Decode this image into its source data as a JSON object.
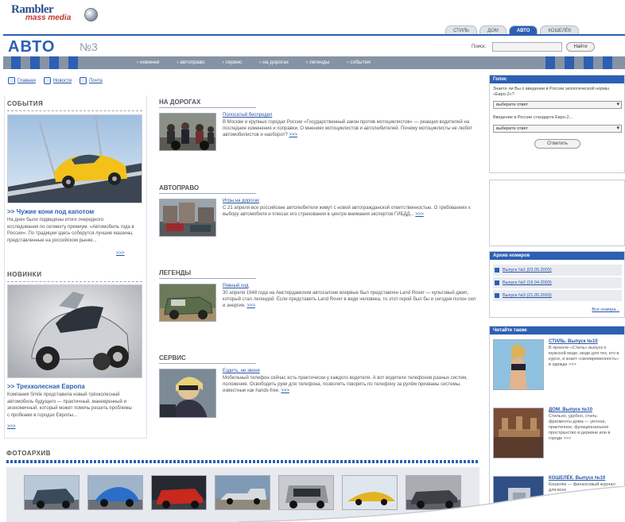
{
  "header": {
    "logo_line1": "Rambler",
    "logo_line2": "mass media",
    "tabs": [
      "СТИЛЬ",
      "ДОМ",
      "АВТО",
      "КОШЕЛЁК"
    ],
    "active_tab": "АВТО",
    "title": "АВТО",
    "issue": "№3",
    "search_label": "Поиск:",
    "search_placeholder": "",
    "search_button": "Найти"
  },
  "nav": {
    "items": [
      "› новинки",
      "› автоправо",
      "› сервис",
      "› на дорогах",
      "› легенды",
      "› события"
    ]
  },
  "subnav": {
    "items": [
      "Главная",
      "Новости",
      "Почта"
    ]
  },
  "left": {
    "events_heading": "СОБЫТИЯ",
    "events_title": ">> Чужие кони под капотом",
    "events_text": "На днях были подведены итоги очередного исследования по сегменту премиум, «Автомобиль года в России». По традиции здесь соберутся лучшие машины, представленные на российском рынке...",
    "more": ">>>",
    "new_heading": "НОВИНКИ",
    "new_title": ">> Трехколесная Европа",
    "new_text": "Компания Smile представила новый трёхколесный автомобиль будущего — практичный, маневренный и экономичный, который может помочь решить проблемы с пробками в городах Европы..."
  },
  "middle": [
    {
      "heading": "НА ДОРОГАХ",
      "title": "Полосатый беспредел",
      "text": "В Москве и крупных городах России «Государственный закон против мотоциклистов» — реакция водителей на последние изменения и поправки. О мнениях мотоциклистов и автолюбителей. Почему мотоциклисты не любят автомобилистов и наоборот?",
      "more": ">>>"
    },
    {
      "heading": "АВТОПРАВО",
      "title": "Игры на дорогах",
      "text": "С 21 апреля все российские автолюбители живут с новой автогражданской ответственностью. О требованиях к выбору автомобиля и плюсах его страхования в центре внимания экспертов ГИБДД...",
      "more": ">>>"
    },
    {
      "heading": "ЛЕГЕНДЫ",
      "title": "Ровный ход",
      "text": "30 апреля 1948 года на Амстердамском автосалоне впервые был представлен Land Rover — культовый джип, который стал легендой. Если представить Land Rover в виде человека, то этот герой был бы и сегодня полон сил и энергии.",
      "more": ">>>"
    },
    {
      "heading": "СЕРВИС",
      "title": "Ездить, не звоня",
      "text": "Мобильный телефон сейчас есть практически у каждого водителя. А вот водители телефонов разных систем, положение. Освободить руки для телефона, позволить говорить по телефону за рулём призваны системы, известные как hands-free.",
      "more": ">>>"
    }
  ],
  "right": {
    "poll_head": "Голос",
    "poll_q1": "Знаете ли Вы о введении в России экологической нормы «Евро-2»?",
    "poll_sel1": "выберите ответ",
    "poll_q2": "Введение в России стандарта Евро-2...",
    "poll_sel2": "выберите ответ",
    "poll_btn": "Ответить",
    "archive_head": "Архив номеров",
    "archive": [
      "Выпуск №1 (03.05.2003)",
      "Выпуск №2 (16.04.2003)",
      "Выпуск №3 (21.05.2003)"
    ],
    "archive_all": "Все номера...",
    "journals_head": "Читайте также",
    "journals": [
      {
        "title": "СТИЛЬ. Выпуск №10",
        "text": "В проекте «Стиль» выпуск о мужской моде, моде для тех, кто в курсе, и знает «своевременность» в одежде >>>"
      },
      {
        "title": "ДОМ. Выпуск №10",
        "text": "Стильно, удобно, стиль: фрагменты дома — уютное, практичное, функциональное пространство в деревне или в городе >>>"
      },
      {
        "title": "КОШЕЛЁК. Выпуск №10",
        "text": "Кошелёк — финансовый журнал для всех"
      }
    ]
  },
  "photo": {
    "heading": "ФОТОАРХИВ"
  }
}
